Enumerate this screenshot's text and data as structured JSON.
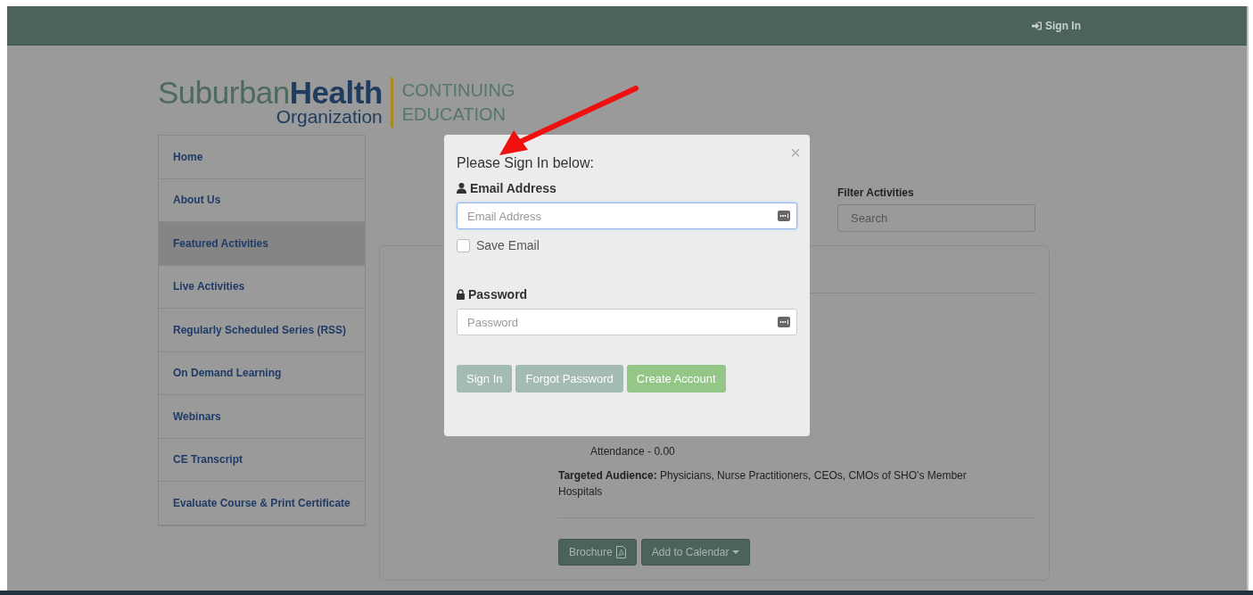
{
  "navbar": {
    "sign_in": "Sign In"
  },
  "logo": {
    "brand_first": "Suburban",
    "brand_second": "Health",
    "brand_sub": "Organization",
    "tagline_1": "CONTINUING",
    "tagline_2": "EDUCATION"
  },
  "sidebar": {
    "items": [
      {
        "label": "Home",
        "selected": false
      },
      {
        "label": "About Us",
        "selected": false
      },
      {
        "label": "Featured Activities",
        "selected": true
      },
      {
        "label": "Live Activities",
        "selected": false
      },
      {
        "label": "Regularly Scheduled Series (RSS)",
        "selected": false
      },
      {
        "label": "On Demand Learning",
        "selected": false
      },
      {
        "label": "Webinars",
        "selected": false
      },
      {
        "label": "CE Transcript",
        "selected": false
      },
      {
        "label": "Evaluate Course & Print Certificate",
        "selected": false
      }
    ]
  },
  "filter": {
    "label": "Filter Activities",
    "placeholder": "Search"
  },
  "activity": {
    "credits": [
      "Attendance - 0.00"
    ],
    "audience": "**Targeted Audience:** Physicians, Nurse Practitioners, CEOs, CMOs of SHO's Member Hospitals",
    "buttons": [
      {
        "label": "Brochure",
        "kind": "pdf"
      },
      {
        "label": "Add to Calendar",
        "kind": "dropdown"
      }
    ]
  },
  "modal": {
    "close": "×",
    "title": "Please Sign In below:",
    "email": {
      "label": "Email Address",
      "placeholder": "Email Address"
    },
    "save_email": {
      "label": "Save Email",
      "checked": false
    },
    "password": {
      "label": "Password",
      "placeholder": "Password"
    },
    "buttons": [
      {
        "label": "Sign In",
        "kind": "primary"
      },
      {
        "label": "Forgot Password",
        "kind": "default"
      },
      {
        "label": "Create Account",
        "kind": "success"
      }
    ]
  }
}
